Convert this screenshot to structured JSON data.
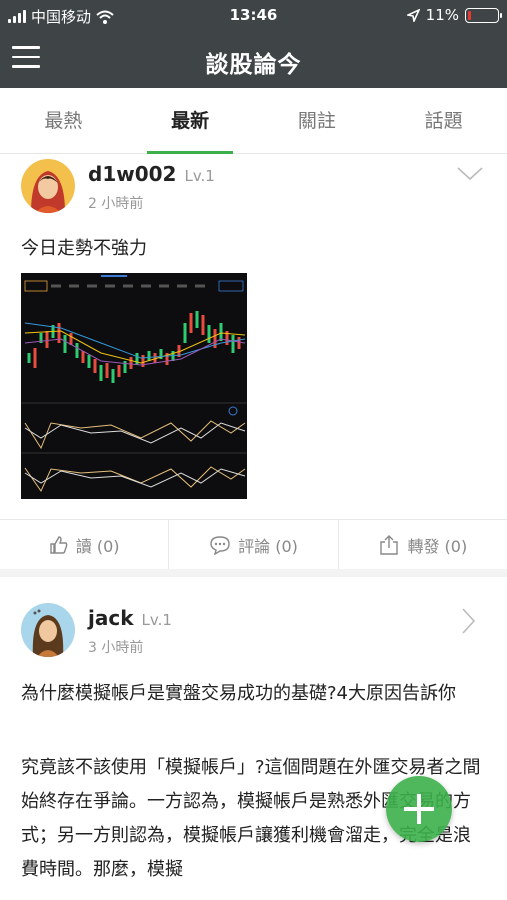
{
  "status": {
    "carrier": "中国移动",
    "time": "13:46",
    "battery": "11%",
    "battery_level": 0.11
  },
  "appbar": {
    "title": "談股論今"
  },
  "tabs": [
    {
      "label": "最熱"
    },
    {
      "label": "最新"
    },
    {
      "label": "關註"
    },
    {
      "label": "話題"
    }
  ],
  "posts": [
    {
      "user": "d1w002",
      "level": "Lv.1",
      "time": "2 小時前",
      "text": "今日走勢不強力",
      "actions": {
        "read": "讀 (0)",
        "comment": "評論 (0)",
        "share": "轉發 (0)"
      }
    },
    {
      "user": "jack",
      "level": "Lv.1",
      "time": "3 小時前",
      "title": "為什麼模擬帳戶是實盤交易成功的基礎?4大原因告訴你",
      "body": "究竟該不該使用「模擬帳戶」?這個問題在外匯交易者之間始終存在爭論。一方認為，模擬帳戶是熟悉外匯交易的方式；另一方則認為，模擬帳戶讓獲利機會溜走，完全是浪費時間。那麼，模擬"
    }
  ],
  "colors": {
    "bar": "#3f4547",
    "accent": "#3cb04b"
  }
}
